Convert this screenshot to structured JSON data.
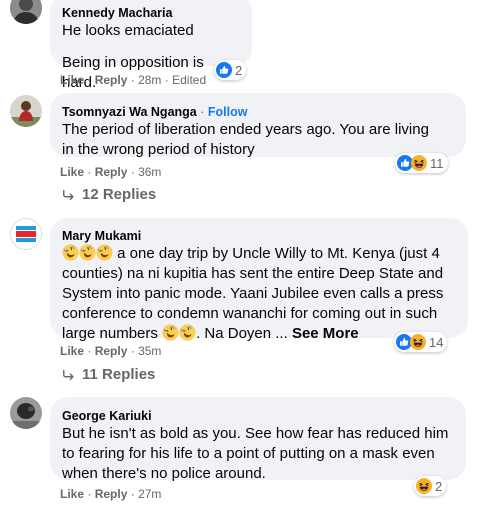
{
  "comments": [
    {
      "name": "Kennedy Macharia",
      "lines": [
        "He looks emaciated",
        "Being in opposition is hard."
      ],
      "like": "Like",
      "reply": "Reply",
      "time": "28m",
      "edited": "Edited",
      "reaction_count": "2",
      "reaction_icons": [
        "like-icon"
      ]
    },
    {
      "name": "Tsomnyazi Wa Nganga",
      "follow": "Follow",
      "lines": [
        "The period of liberation ended years ago. You are living",
        "in the wrong period of history"
      ],
      "like": "Like",
      "reply": "Reply",
      "time": "36m",
      "reaction_count": "11",
      "reaction_icons": [
        "like-icon",
        "haha-icon"
      ],
      "replies": "12 Replies"
    },
    {
      "name": "Mary Mukami",
      "line1": "a one day trip by Uncle Willy to Mt. Kenya (just 4",
      "line2": "counties) na ni kupitia has sent the entire Deep State and",
      "line3": "System into panic mode. Yaani Jubilee even calls a press",
      "line4": "conference to condemn wananchi for coming out in such",
      "line5a": "large numbers",
      "line5b": ". Na Doyen ...",
      "see_more": "See More",
      "like": "Like",
      "reply": "Reply",
      "time": "35m",
      "reaction_count": "14",
      "reaction_icons": [
        "like-icon",
        "haha-icon"
      ],
      "replies": "11 Replies"
    },
    {
      "name": "George Kariuki",
      "lines": [
        "But he isn't as bold as you. See how fear has reduced him",
        "to fearing for his life to a point of putting on a mask even",
        "when there's no police around."
      ],
      "like": "Like",
      "reply": "Reply",
      "time": "27m",
      "reaction_count": "2",
      "reaction_icons": [
        "haha-icon"
      ]
    }
  ],
  "avatar_badge_text": [
    "VOICE",
    "MATTERS"
  ],
  "colors": {
    "link": "#1877f2",
    "bubble": "#f0f2f5",
    "meta": "#65676b",
    "text": "#050505",
    "haha": "#f7b125"
  }
}
